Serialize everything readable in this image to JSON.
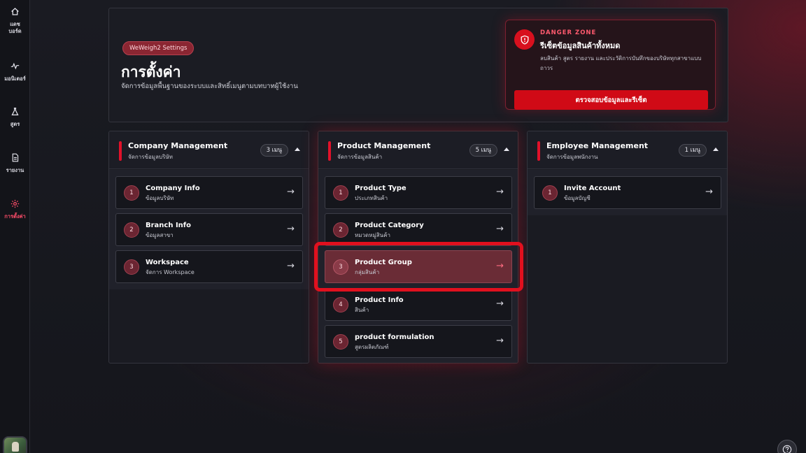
{
  "sidebar": {
    "items": [
      {
        "label": "แดช\nบอร์ด",
        "icon": "home-icon"
      },
      {
        "label": "มอนิเตอร์",
        "icon": "monitor-icon"
      },
      {
        "label": "สูตร",
        "icon": "flask-icon"
      },
      {
        "label": "รายงาน",
        "icon": "document-icon"
      },
      {
        "label": "การตั้งค่า",
        "icon": "gear-icon",
        "active": true
      }
    ]
  },
  "hero": {
    "badge": "WeWeigh2 Settings",
    "title": "การตั้งค่า",
    "subtitle": "จัดการข้อมูลพื้นฐานของระบบและสิทธิ์เมนูตามบทบาทผู้ใช้งาน"
  },
  "danger": {
    "tag": "DANGER ZONE",
    "title": "รีเซ็ตข้อมูลสินค้าทั้งหมด",
    "description": "ลบสินค้า สูตร รายงาน และประวัติการบันทึกของบริษัททุกสาขาแบบถาวร",
    "button": "ตรวจสอบข้อมูลและรีเซ็ต"
  },
  "columns": [
    {
      "title": "Company Management",
      "subtitle": "จัดการข้อมูลบริษัท",
      "count": "3 เมนู",
      "items": [
        {
          "n": "1",
          "title": "Company Info",
          "sub": "ข้อมูลบริษัท"
        },
        {
          "n": "2",
          "title": "Branch Info",
          "sub": "ข้อมูลสาขา"
        },
        {
          "n": "3",
          "title": "Workspace",
          "sub": "จัดการ Workspace"
        }
      ]
    },
    {
      "title": "Product Management",
      "subtitle": "จัดการข้อมูลสินค้า",
      "count": "5 เมนู",
      "items": [
        {
          "n": "1",
          "title": "Product Type",
          "sub": "ประเภทสินค้า"
        },
        {
          "n": "2",
          "title": "Product Category",
          "sub": "หมวดหมู่สินค้า"
        },
        {
          "n": "3",
          "title": "Product Group",
          "sub": "กลุ่มสินค้า"
        },
        {
          "n": "4",
          "title": "Product Info",
          "sub": "สินค้า"
        },
        {
          "n": "5",
          "title": "product formulation",
          "sub": "สูตรผลิตภัณฑ์"
        }
      ]
    },
    {
      "title": "Employee Management",
      "subtitle": "จัดการข้อมูลพนักงาน",
      "count": "1 เมนู",
      "items": [
        {
          "n": "1",
          "title": "Invite Account",
          "sub": "ข้อมูลบัญชี"
        }
      ]
    }
  ],
  "arrow_glyph": "→",
  "colors": {
    "accent": "#e2112a",
    "danger_button": "#d00a16",
    "highlight_item": "#6a2c36"
  }
}
